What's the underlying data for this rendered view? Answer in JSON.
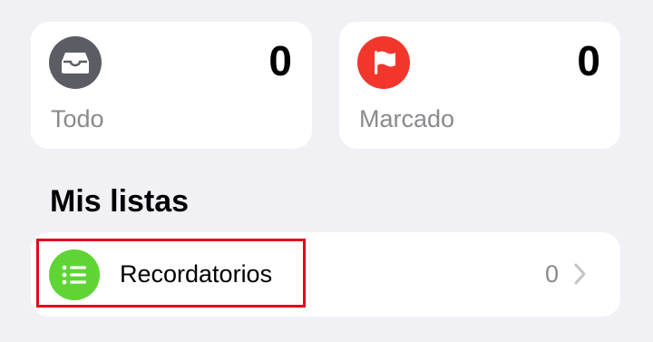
{
  "tiles": [
    {
      "label": "Todo",
      "count": "0",
      "icon": "tray-icon",
      "color": "#5b5d64"
    },
    {
      "label": "Marcado",
      "count": "0",
      "icon": "flag-icon",
      "color": "#f2362c"
    }
  ],
  "my_lists": {
    "heading": "Mis listas",
    "items": [
      {
        "label": "Recordatorios",
        "count": "0",
        "icon": "list-bullet-icon",
        "color": "#5ed534"
      }
    ]
  },
  "colors": {
    "background": "#f1f0f5",
    "highlight": "#e00a1d",
    "secondary_text": "#8a8a8e"
  }
}
